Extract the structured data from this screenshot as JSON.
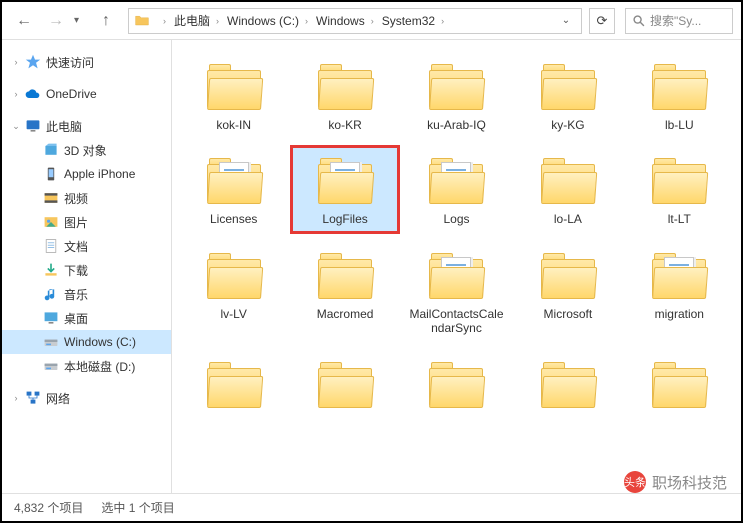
{
  "breadcrumbs": [
    "此电脑",
    "Windows (C:)",
    "Windows",
    "System32"
  ],
  "search": {
    "placeholder": "搜索\"Sy..."
  },
  "sidebar": {
    "quick_access": "快速访问",
    "onedrive": "OneDrive",
    "this_pc": "此电脑",
    "children": [
      {
        "label": "3D 对象",
        "icon": "3d"
      },
      {
        "label": "Apple iPhone",
        "icon": "phone"
      },
      {
        "label": "视频",
        "icon": "video"
      },
      {
        "label": "图片",
        "icon": "pictures"
      },
      {
        "label": "文档",
        "icon": "documents"
      },
      {
        "label": "下载",
        "icon": "downloads"
      },
      {
        "label": "音乐",
        "icon": "music"
      },
      {
        "label": "桌面",
        "icon": "desktop"
      },
      {
        "label": "Windows (C:)",
        "icon": "drive",
        "selected": true
      },
      {
        "label": "本地磁盘 (D:)",
        "icon": "drive"
      }
    ],
    "network": "网络"
  },
  "folders": [
    {
      "name": "kok-IN",
      "type": "folder"
    },
    {
      "name": "ko-KR",
      "type": "folder"
    },
    {
      "name": "ku-Arab-IQ",
      "type": "folder"
    },
    {
      "name": "ky-KG",
      "type": "folder"
    },
    {
      "name": "lb-LU",
      "type": "folder"
    },
    {
      "name": "Licenses",
      "type": "doc"
    },
    {
      "name": "LogFiles",
      "type": "doc",
      "selected": true,
      "highlight": true
    },
    {
      "name": "Logs",
      "type": "doc"
    },
    {
      "name": "lo-LA",
      "type": "folder"
    },
    {
      "name": "lt-LT",
      "type": "folder"
    },
    {
      "name": "lv-LV",
      "type": "folder"
    },
    {
      "name": "Macromed",
      "type": "folder"
    },
    {
      "name": "MailContactsCalendarSync",
      "type": "doc"
    },
    {
      "name": "Microsoft",
      "type": "folder"
    },
    {
      "name": "migration",
      "type": "doc"
    },
    {
      "name": "",
      "type": "folder"
    },
    {
      "name": "",
      "type": "folder"
    },
    {
      "name": "",
      "type": "folder"
    },
    {
      "name": "",
      "type": "folder"
    },
    {
      "name": "",
      "type": "folder"
    }
  ],
  "status": {
    "count": "4,832 个项目",
    "selected": "选中 1 个项目"
  },
  "watermark": "职场科技范"
}
